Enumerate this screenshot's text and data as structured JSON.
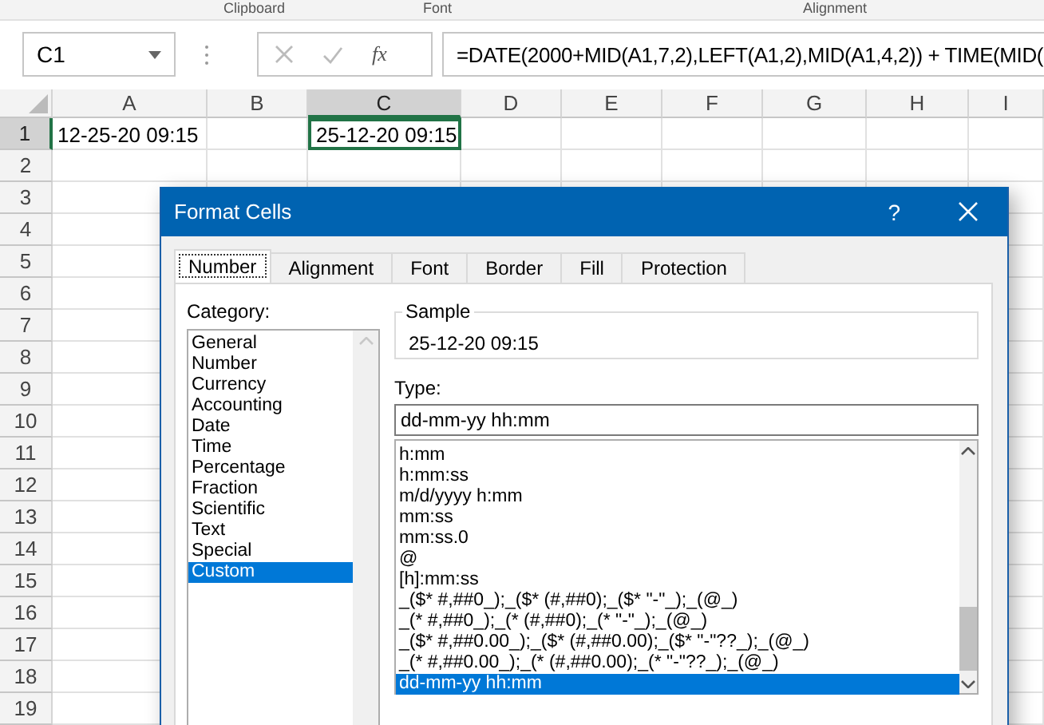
{
  "ribbon_groups": [
    "Clipboard",
    "Font",
    "Alignment"
  ],
  "name_box": {
    "value": "C1"
  },
  "function_button": {
    "label": "fx"
  },
  "formula_bar": {
    "value": "=DATE(2000+MID(A1,7,2),LEFT(A1,2),MID(A1,4,2)) + TIME(MID("
  },
  "sheet": {
    "columns": [
      {
        "label": "A",
        "selected": false
      },
      {
        "label": "B",
        "selected": false
      },
      {
        "label": "C",
        "selected": true
      },
      {
        "label": "D",
        "selected": false
      },
      {
        "label": "E",
        "selected": false
      },
      {
        "label": "F",
        "selected": false
      },
      {
        "label": "G",
        "selected": false
      },
      {
        "label": "H",
        "selected": false
      },
      {
        "label": "I",
        "selected": false
      }
    ],
    "rows": [
      {
        "label": "1",
        "selected": true,
        "cells": [
          {
            "value": "12-25-20 09:15",
            "selected": false
          },
          null,
          {
            "value": "25-12-20 09:15",
            "selected": true
          }
        ]
      },
      {
        "label": "2",
        "selected": false
      },
      {
        "label": "3",
        "selected": false
      },
      {
        "label": "4",
        "selected": false
      },
      {
        "label": "5",
        "selected": false
      },
      {
        "label": "6",
        "selected": false
      },
      {
        "label": "7",
        "selected": false
      },
      {
        "label": "8",
        "selected": false
      },
      {
        "label": "9",
        "selected": false
      },
      {
        "label": "10",
        "selected": false
      },
      {
        "label": "11",
        "selected": false
      },
      {
        "label": "12",
        "selected": false
      },
      {
        "label": "13",
        "selected": false
      },
      {
        "label": "14",
        "selected": false
      },
      {
        "label": "15",
        "selected": false
      },
      {
        "label": "16",
        "selected": false
      },
      {
        "label": "17",
        "selected": false
      },
      {
        "label": "18",
        "selected": false
      },
      {
        "label": "19",
        "selected": false
      }
    ]
  },
  "dialog": {
    "title": "Format Cells",
    "help": "?",
    "tabs": [
      {
        "label": "Number",
        "selected": true
      },
      {
        "label": "Alignment",
        "selected": false
      },
      {
        "label": "Font",
        "selected": false
      },
      {
        "label": "Border",
        "selected": false
      },
      {
        "label": "Fill",
        "selected": false
      },
      {
        "label": "Protection",
        "selected": false
      }
    ],
    "category_label": "Category:",
    "categories": [
      {
        "label": "General",
        "selected": false
      },
      {
        "label": "Number",
        "selected": false
      },
      {
        "label": "Currency",
        "selected": false
      },
      {
        "label": "Accounting",
        "selected": false
      },
      {
        "label": "Date",
        "selected": false
      },
      {
        "label": "Time",
        "selected": false
      },
      {
        "label": "Percentage",
        "selected": false
      },
      {
        "label": "Fraction",
        "selected": false
      },
      {
        "label": "Scientific",
        "selected": false
      },
      {
        "label": "Text",
        "selected": false
      },
      {
        "label": "Special",
        "selected": false
      },
      {
        "label": "Custom",
        "selected": true
      }
    ],
    "sample": {
      "label": "Sample",
      "value": "25-12-20 09:15"
    },
    "type_label": "Type:",
    "type_input": {
      "value": "dd-mm-yy hh:mm"
    },
    "type_list": [
      {
        "label": "h:mm",
        "selected": false
      },
      {
        "label": "h:mm:ss",
        "selected": false
      },
      {
        "label": "m/d/yyyy h:mm",
        "selected": false
      },
      {
        "label": "mm:ss",
        "selected": false
      },
      {
        "label": "mm:ss.0",
        "selected": false
      },
      {
        "label": "@",
        "selected": false
      },
      {
        "label": "[h]:mm:ss",
        "selected": false
      },
      {
        "label": "_($* #,##0_);_($* (#,##0);_($* \"-\"_);_(@_)",
        "selected": false
      },
      {
        "label": "_(* #,##0_);_(* (#,##0);_(* \"-\"_);_(@_)",
        "selected": false
      },
      {
        "label": "_($* #,##0.00_);_($* (#,##0.00);_($* \"-\"??_);_(@_)",
        "selected": false
      },
      {
        "label": "_(* #,##0.00_);_(* (#,##0.00);_(* \"-\"??_);_(@_)",
        "selected": false
      },
      {
        "label": "dd-mm-yy hh:mm",
        "selected": true
      }
    ]
  }
}
